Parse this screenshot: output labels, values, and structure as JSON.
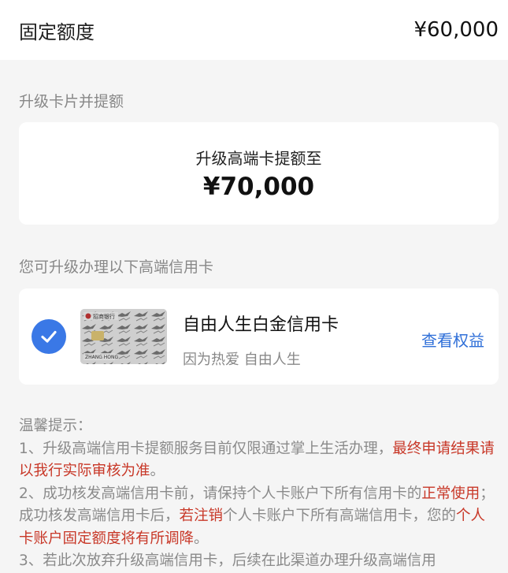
{
  "fixed_limit": {
    "label": "固定额度",
    "amount": "¥60,000"
  },
  "upgrade_section": {
    "title": "升级卡片并提额",
    "caption": "升级高端卡提额至",
    "amount": "¥70,000"
  },
  "cards_section": {
    "title": "您可升级办理以下高端信用卡",
    "card": {
      "name": "自由人生白金信用卡",
      "slogan": "因为热爱 自由人生",
      "benefit_link": "查看权益",
      "selected": true,
      "thumbnail_bank_text": "招商银行",
      "thumbnail_holder_text": "ZHANG HONG"
    }
  },
  "tips": {
    "title": "温馨提示：",
    "item1": {
      "prefix": "1、升级高端信用卡提额服务目前仅限通过掌上生活办理，",
      "highlight": "最终申请结果请以我行实际审核为准",
      "suffix": "。"
    },
    "item2": {
      "part1": "2、成功核发高端信用卡前，请保持个人卡账户下所有信用卡的",
      "hl1": "正常使用",
      "part2": "；成功核发高端信用卡后，",
      "hl2": "若注销",
      "part3": "个人卡账户下所有高端信用卡，您的",
      "hl3": "个人卡账户固定额度将有所调降",
      "part4": "。"
    },
    "item3": {
      "text": "3、若此次放弃升级高端信用卡，后续在此渠道办理升级高端信用"
    }
  },
  "colors": {
    "accent_blue": "#3a78e6",
    "link_blue": "#2f6fd8",
    "highlight_red": "#c83828",
    "background": "#f5f5f5"
  }
}
